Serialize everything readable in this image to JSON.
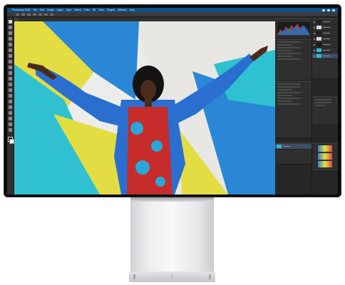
{
  "screenshot": {
    "menubar": {
      "app_name": "Photoshop 2020",
      "items": [
        "File",
        "Edit",
        "Image",
        "Layer",
        "Type",
        "Select",
        "Filter",
        "3D",
        "View",
        "Plugins",
        "Window",
        "Help"
      ]
    },
    "document": {
      "window_title": "",
      "tab_label": "",
      "zoom": ""
    },
    "panels": {
      "histogram_title": "",
      "properties_title": "",
      "layers_title": "",
      "history_title": ""
    },
    "colors": {
      "menubar_bg": "#0e4f86",
      "ui_dark": "#262626",
      "panel_bg": "#2f2f2f",
      "photo_yellow": "#e3dd43",
      "photo_cyan": "#2fc1d2",
      "photo_blue": "#2a87d6",
      "photo_jacket": "#2a6fd0",
      "photo_dress_red": "#c62c2c",
      "stand_silver": "#e6e8ea"
    }
  }
}
